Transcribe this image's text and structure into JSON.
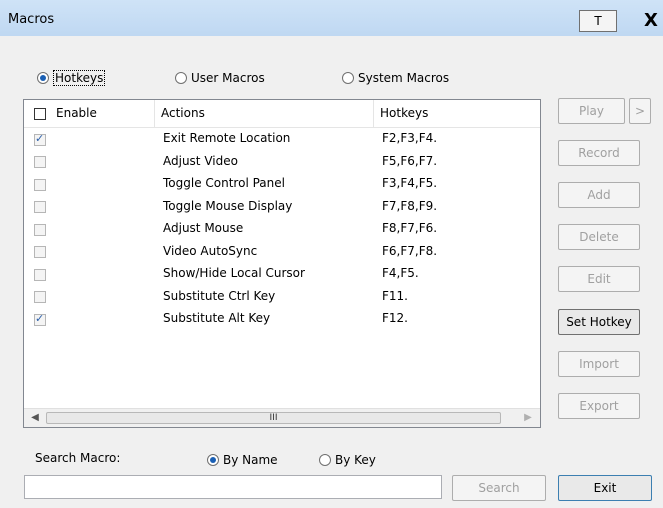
{
  "window": {
    "title": "Macros",
    "pin_label": "T",
    "close_label": "X"
  },
  "macro_type": {
    "options": [
      "Hotkeys",
      "User Macros",
      "System Macros"
    ],
    "selected": "Hotkeys"
  },
  "table": {
    "headers": {
      "enable": "Enable",
      "actions": "Actions",
      "hotkeys": "Hotkeys"
    },
    "rows": [
      {
        "enabled": true,
        "action": "Exit Remote Location",
        "hotkeys": "F2,F3,F4."
      },
      {
        "enabled": false,
        "action": "Adjust Video",
        "hotkeys": "F5,F6,F7."
      },
      {
        "enabled": false,
        "action": "Toggle Control Panel",
        "hotkeys": "F3,F4,F5."
      },
      {
        "enabled": false,
        "action": "Toggle Mouse Display",
        "hotkeys": "F7,F8,F9."
      },
      {
        "enabled": false,
        "action": "Adjust Mouse",
        "hotkeys": "F8,F7,F6."
      },
      {
        "enabled": false,
        "action": "Video AutoSync",
        "hotkeys": "F6,F7,F8."
      },
      {
        "enabled": false,
        "action": "Show/Hide Local Cursor",
        "hotkeys": "F4,F5."
      },
      {
        "enabled": false,
        "action": "Substitute Ctrl Key",
        "hotkeys": "F11."
      },
      {
        "enabled": true,
        "action": "Substitute Alt Key",
        "hotkeys": "F12."
      }
    ],
    "scroll_thumb_label": "III"
  },
  "side_buttons": {
    "play": "Play",
    "more": ">",
    "record": "Record",
    "add": "Add",
    "delete": "Delete",
    "edit": "Edit",
    "set_hotkey": "Set Hotkey",
    "import": "Import",
    "export": "Export"
  },
  "search": {
    "label": "Search Macro:",
    "value": "",
    "modes": [
      "By Name",
      "By Key"
    ],
    "selected_mode": "By Name",
    "button": "Search"
  },
  "exit_button": "Exit",
  "colors": {
    "titlebar": "#bfd8f2",
    "accent": "#1a5fb4",
    "focus_border": "#3c7fb1"
  }
}
